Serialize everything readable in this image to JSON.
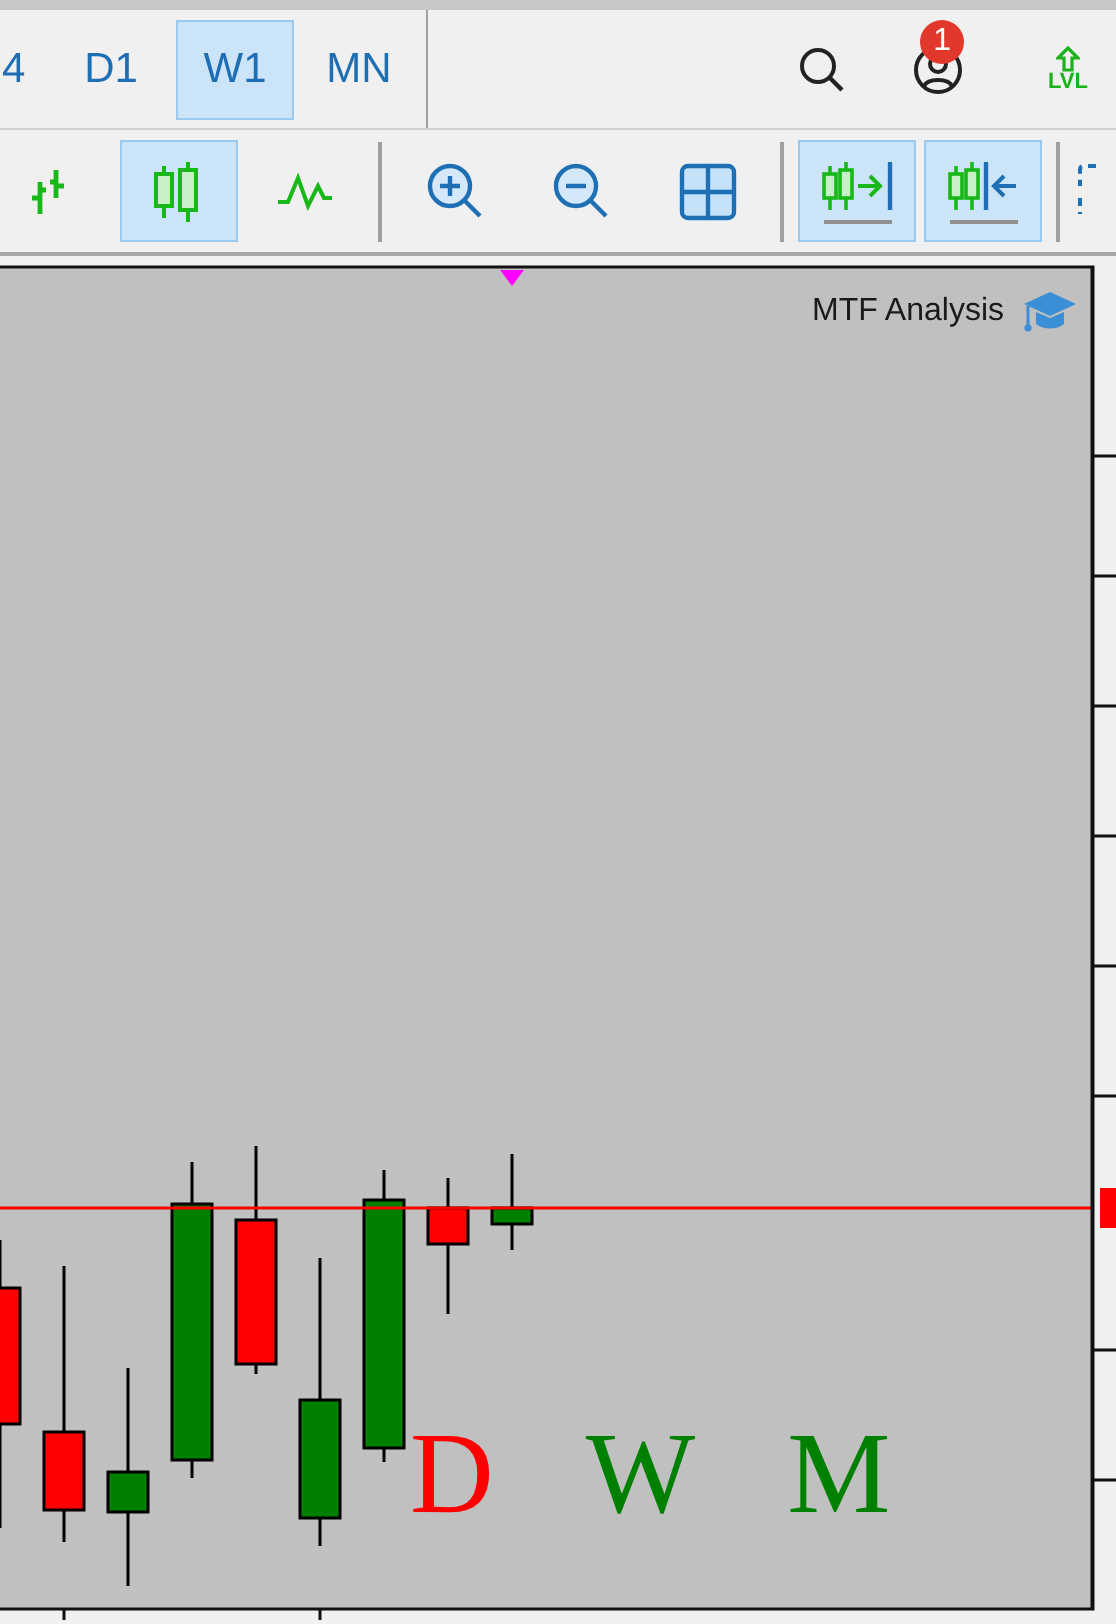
{
  "toolbar": {
    "timeframes": [
      {
        "label": "4",
        "selected": false
      },
      {
        "label": "D1",
        "selected": false
      },
      {
        "label": "W1",
        "selected": true
      },
      {
        "label": "MN",
        "selected": false
      }
    ],
    "notifications_badge": "1",
    "level_button": "LVL"
  },
  "chart_toolbar": {
    "tools": [
      {
        "kind": "bars",
        "selected": false
      },
      {
        "kind": "candles",
        "selected": true
      },
      {
        "kind": "line",
        "selected": false
      },
      {
        "kind": "separator"
      },
      {
        "kind": "zoom-in",
        "selected": false
      },
      {
        "kind": "zoom-out",
        "selected": false
      },
      {
        "kind": "grid",
        "selected": false
      },
      {
        "kind": "separator"
      },
      {
        "kind": "autoscroll",
        "selected": true
      },
      {
        "kind": "shift",
        "selected": true
      },
      {
        "kind": "separator"
      },
      {
        "kind": "more",
        "selected": false
      }
    ]
  },
  "chart": {
    "indicator_label": "MTF Analysis",
    "timeframe_letters": [
      {
        "label": "D",
        "color": "#ff0000"
      },
      {
        "label": "W",
        "color": "#008000"
      },
      {
        "label": "M",
        "color": "#008000"
      }
    ]
  }
}
